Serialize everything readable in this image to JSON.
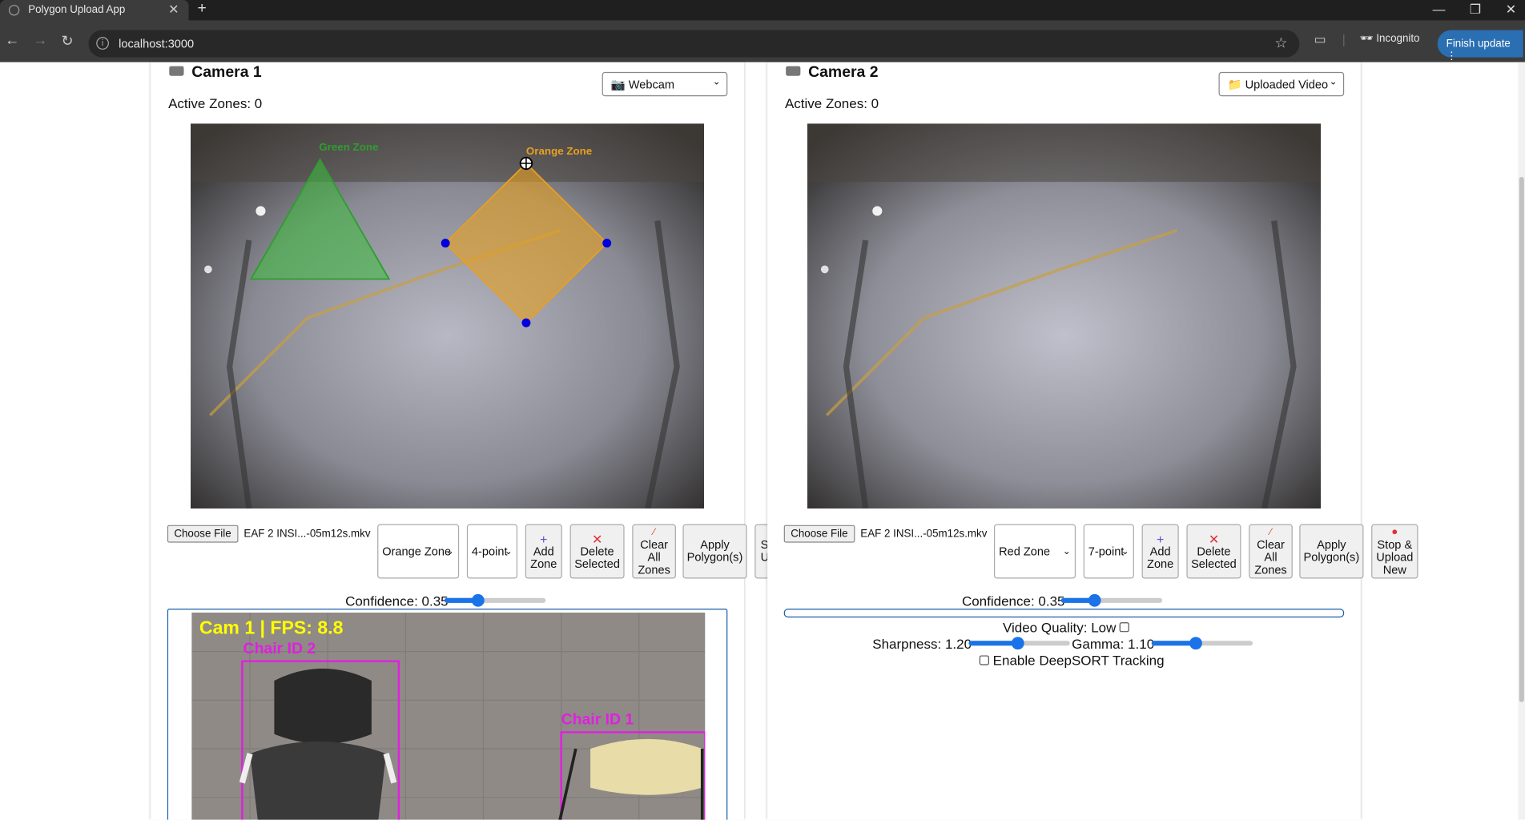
{
  "browser": {
    "tab_title": "Polygon Upload App",
    "new_tab": "+",
    "url": "localhost:3000",
    "incognito": "Incognito",
    "finish_update": "Finish update"
  },
  "cameras": [
    {
      "title": "Camera 1",
      "active_zones": "Active Zones: 0",
      "source": "📷 Webcam",
      "zones_on_video": [
        {
          "label": "Green Zone",
          "color": "#2e9e2e"
        },
        {
          "label": "Orange Zone",
          "color": "#e8a020"
        }
      ],
      "file_button": "Choose File",
      "file_name": "EAF 2 INSI...-05m12s.mkv",
      "zone_select": "Orange Zone",
      "point_select": "4-point",
      "buttons": {
        "add": [
          "Add",
          "Zone"
        ],
        "delete": [
          "Delete",
          "Selected"
        ],
        "clear": [
          "Clear",
          "All",
          "Zones"
        ],
        "apply": [
          "Apply",
          "Polygon(s)"
        ],
        "stop_partial": [
          "S",
          "U"
        ]
      },
      "confidence": "Confidence: 0.35",
      "confidence_value": 0.35,
      "preview": {
        "overlay": "Cam 1 | FPS: 8.8",
        "detections": [
          "Chair ID 2",
          "Chair ID 1"
        ]
      }
    },
    {
      "title": "Camera 2",
      "active_zones": "Active Zones: 0",
      "source": "📁 Uploaded Video",
      "file_button": "Choose File",
      "file_name": "EAF 2 INSI...-05m12s.mkv",
      "zone_select": "Red Zone",
      "point_select": "7-point",
      "buttons": {
        "add": [
          "Add",
          "Zone"
        ],
        "delete": [
          "Delete",
          "Selected"
        ],
        "clear": [
          "Clear",
          "All",
          "Zones"
        ],
        "apply": [
          "Apply",
          "Polygon(s)"
        ],
        "stop": [
          "Stop &",
          "Upload",
          "New"
        ]
      },
      "confidence": "Confidence: 0.35",
      "confidence_value": 0.35,
      "video_quality": "Video Quality: Low",
      "sharpness": "Sharpness: 1.20",
      "gamma": "Gamma: 1.10",
      "deepsort": "Enable DeepSORT Tracking"
    }
  ],
  "colors": {
    "accent": "#1a73e8",
    "detection": "#e020e0",
    "overlay_text": "#ffff00",
    "delete": "#e0303a"
  }
}
